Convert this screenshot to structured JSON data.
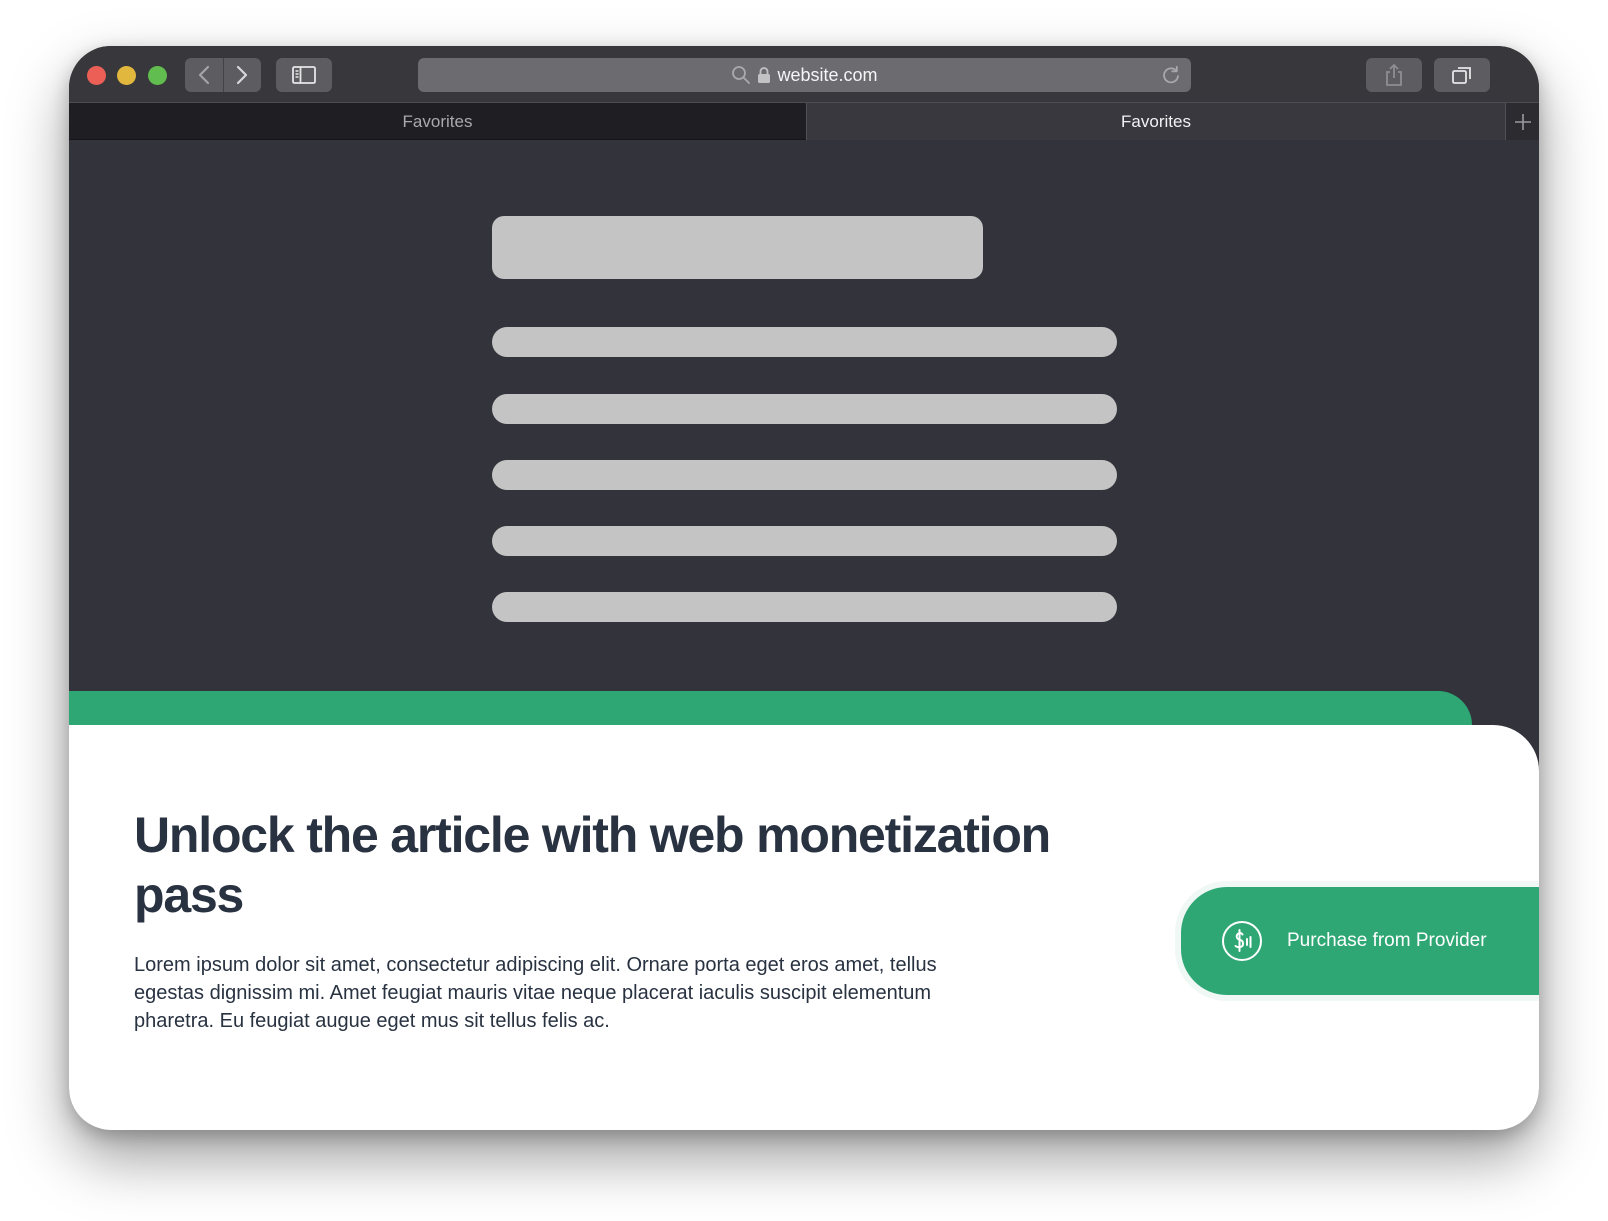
{
  "browser": {
    "url": "website.com",
    "tabs": [
      {
        "label": "Favorites",
        "active": false
      },
      {
        "label": "Favorites",
        "active": true
      }
    ],
    "icons": {
      "back": "chevron-left-icon",
      "forward": "chevron-right-icon",
      "sidebar": "sidebar-icon",
      "search": "search-icon",
      "lock": "lock-icon",
      "reload": "reload-icon",
      "share": "share-icon",
      "tabs": "tabs-overview-icon",
      "new_tab": "plus-icon"
    }
  },
  "paywall": {
    "heading": "Unlock the article with web monetization pass",
    "body": "Lorem ipsum dolor sit amet, consectetur adipiscing elit. Ornare porta eget eros amet, tellus egestas dignissim mi. Amet feugiat mauris vitae neque placerat iaculis suscipit elementum pharetra. Eu feugiat augue eget mus sit tellus felis ac.",
    "button_label": "Purchase from Provider",
    "button_icon": "dollar-monetization-icon"
  },
  "colors": {
    "accent_green": "#2ea774",
    "page_background": "#33333b",
    "skeleton": "#c4c4c4",
    "heading_text": "#283241"
  }
}
